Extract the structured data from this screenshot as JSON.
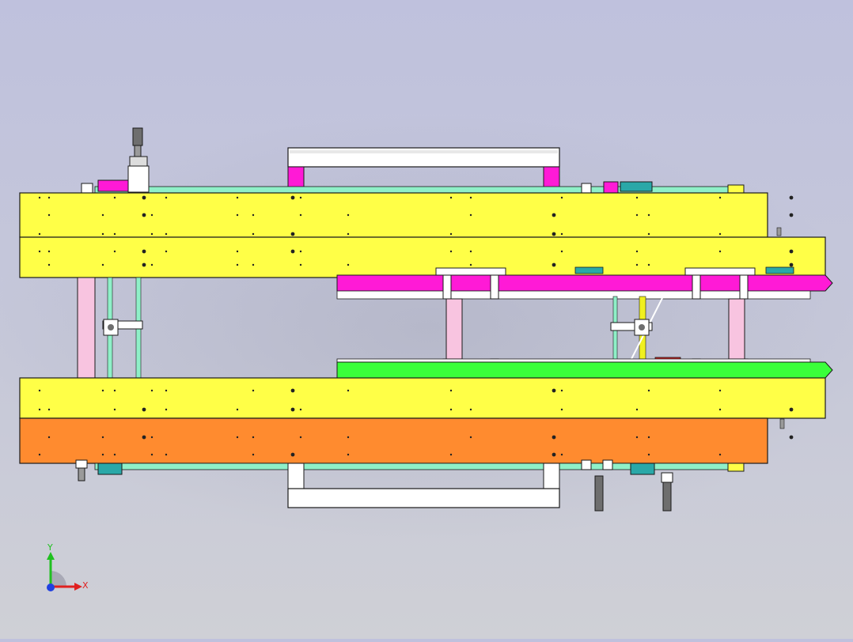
{
  "viewport": {
    "background_top": "#bfc1dd",
    "background_bottom": "#cfd0d6"
  },
  "colors": {
    "frame_yellow": "#ffff47",
    "frame_orange": "#ff8b2f",
    "rail_magenta": "#ff1ad6",
    "rail_green": "#3aff3a",
    "pillar_pink": "#f8c4e0",
    "rod_cyan": "#8ff0c8",
    "rod_yellow": "#f0f020",
    "bracket_white": "#ffffff",
    "sensor_teal": "#2aa8a8",
    "cylinder_grey": "#6e6e6e",
    "outline": "#1a1a1a"
  },
  "triad": {
    "x_label": "X",
    "y_label": "Y",
    "x_color": "#e02020",
    "y_color": "#20c020",
    "z_color": "#2040e0"
  }
}
